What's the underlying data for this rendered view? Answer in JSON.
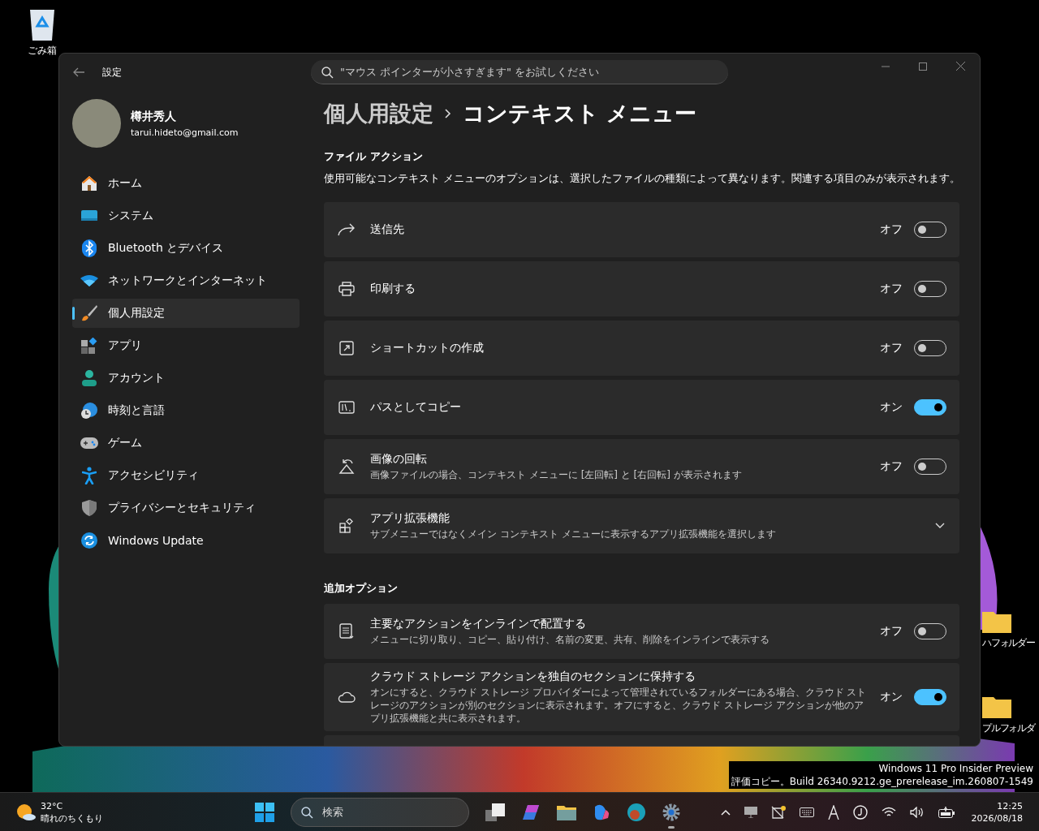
{
  "desktop": {
    "icons": [
      {
        "label": "ごみ箱"
      },
      {
        "label": "ハフォルダー"
      },
      {
        "label": "プルフォルダ"
      }
    ],
    "watermark": [
      "Windows 11 Pro Insider Preview",
      "評価コピー。Build 26340.9212.ge_prerelease_im.260807-1549"
    ]
  },
  "window": {
    "title": "設定",
    "search": {
      "placeholder": "\"マウス ポインターが小さすぎます\" をお試しください"
    }
  },
  "account": {
    "name": "樽井秀人",
    "email": "tarui.hideto@gmail.com"
  },
  "sidebar": {
    "items": [
      {
        "label": "ホーム",
        "selected": false
      },
      {
        "label": "システム",
        "selected": false
      },
      {
        "label": "Bluetooth とデバイス",
        "selected": false
      },
      {
        "label": "ネットワークとインターネット",
        "selected": false
      },
      {
        "label": "個人用設定",
        "selected": true
      },
      {
        "label": "アプリ",
        "selected": false
      },
      {
        "label": "アカウント",
        "selected": false
      },
      {
        "label": "時刻と言語",
        "selected": false
      },
      {
        "label": "ゲーム",
        "selected": false
      },
      {
        "label": "アクセシビリティ",
        "selected": false
      },
      {
        "label": "プライバシーとセキュリティ",
        "selected": false
      },
      {
        "label": "Windows Update",
        "selected": false
      }
    ]
  },
  "breadcrumb": [
    "個人用設定",
    "コンテキスト メニュー"
  ],
  "sections": [
    {
      "title": "ファイル アクション",
      "description": "使用可能なコンテキスト メニューのオプションは、選択したファイルの種類によって異なります。関連する項目のみが表示されます。",
      "rows": [
        {
          "kind": "toggle",
          "title": "送信先",
          "state": "オフ",
          "on": false
        },
        {
          "kind": "toggle",
          "title": "印刷する",
          "state": "オフ",
          "on": false
        },
        {
          "kind": "toggle",
          "title": "ショートカットの作成",
          "state": "オフ",
          "on": false
        },
        {
          "kind": "toggle",
          "title": "パスとしてコピー",
          "state": "オン",
          "on": true
        },
        {
          "kind": "toggle",
          "title": "画像の回転",
          "subtitle": "画像ファイルの場合、コンテキスト メニューに [左回転] と [右回転] が表示されます",
          "state": "オフ",
          "on": false
        },
        {
          "kind": "expand",
          "title": "アプリ拡張機能",
          "subtitle": "サブメニューではなくメイン コンテキスト メニューに表示するアプリ拡張機能を選択します",
          "expanded": false
        }
      ]
    },
    {
      "title": "追加オプション",
      "rows": [
        {
          "kind": "toggle",
          "title": "主要なアクションをインラインで配置する",
          "subtitle": "メニューに切り取り、コピー、貼り付け、名前の変更、共有、削除をインラインで表示する",
          "state": "オフ",
          "on": false
        },
        {
          "kind": "toggle",
          "title": "クラウド ストレージ アクションを独自のセクションに保持する",
          "subtitle": "オンにすると、クラウド ストレージ プロバイダーによって管理されているフォルダーにある場合、クラウド ストレージのアクションが別のセクションに表示されます。オフにすると、クラウド ストレージ アクションが他のアプリ拡張機能と共に表示されます。",
          "state": "オン",
          "on": true
        }
      ]
    }
  ],
  "taskbar": {
    "weather": {
      "temperature": "32°C",
      "condition": "晴れのちくもり"
    },
    "search": {
      "placeholder": "検索"
    },
    "clock": {
      "time": "12:25",
      "date": "2026/08/18"
    }
  }
}
